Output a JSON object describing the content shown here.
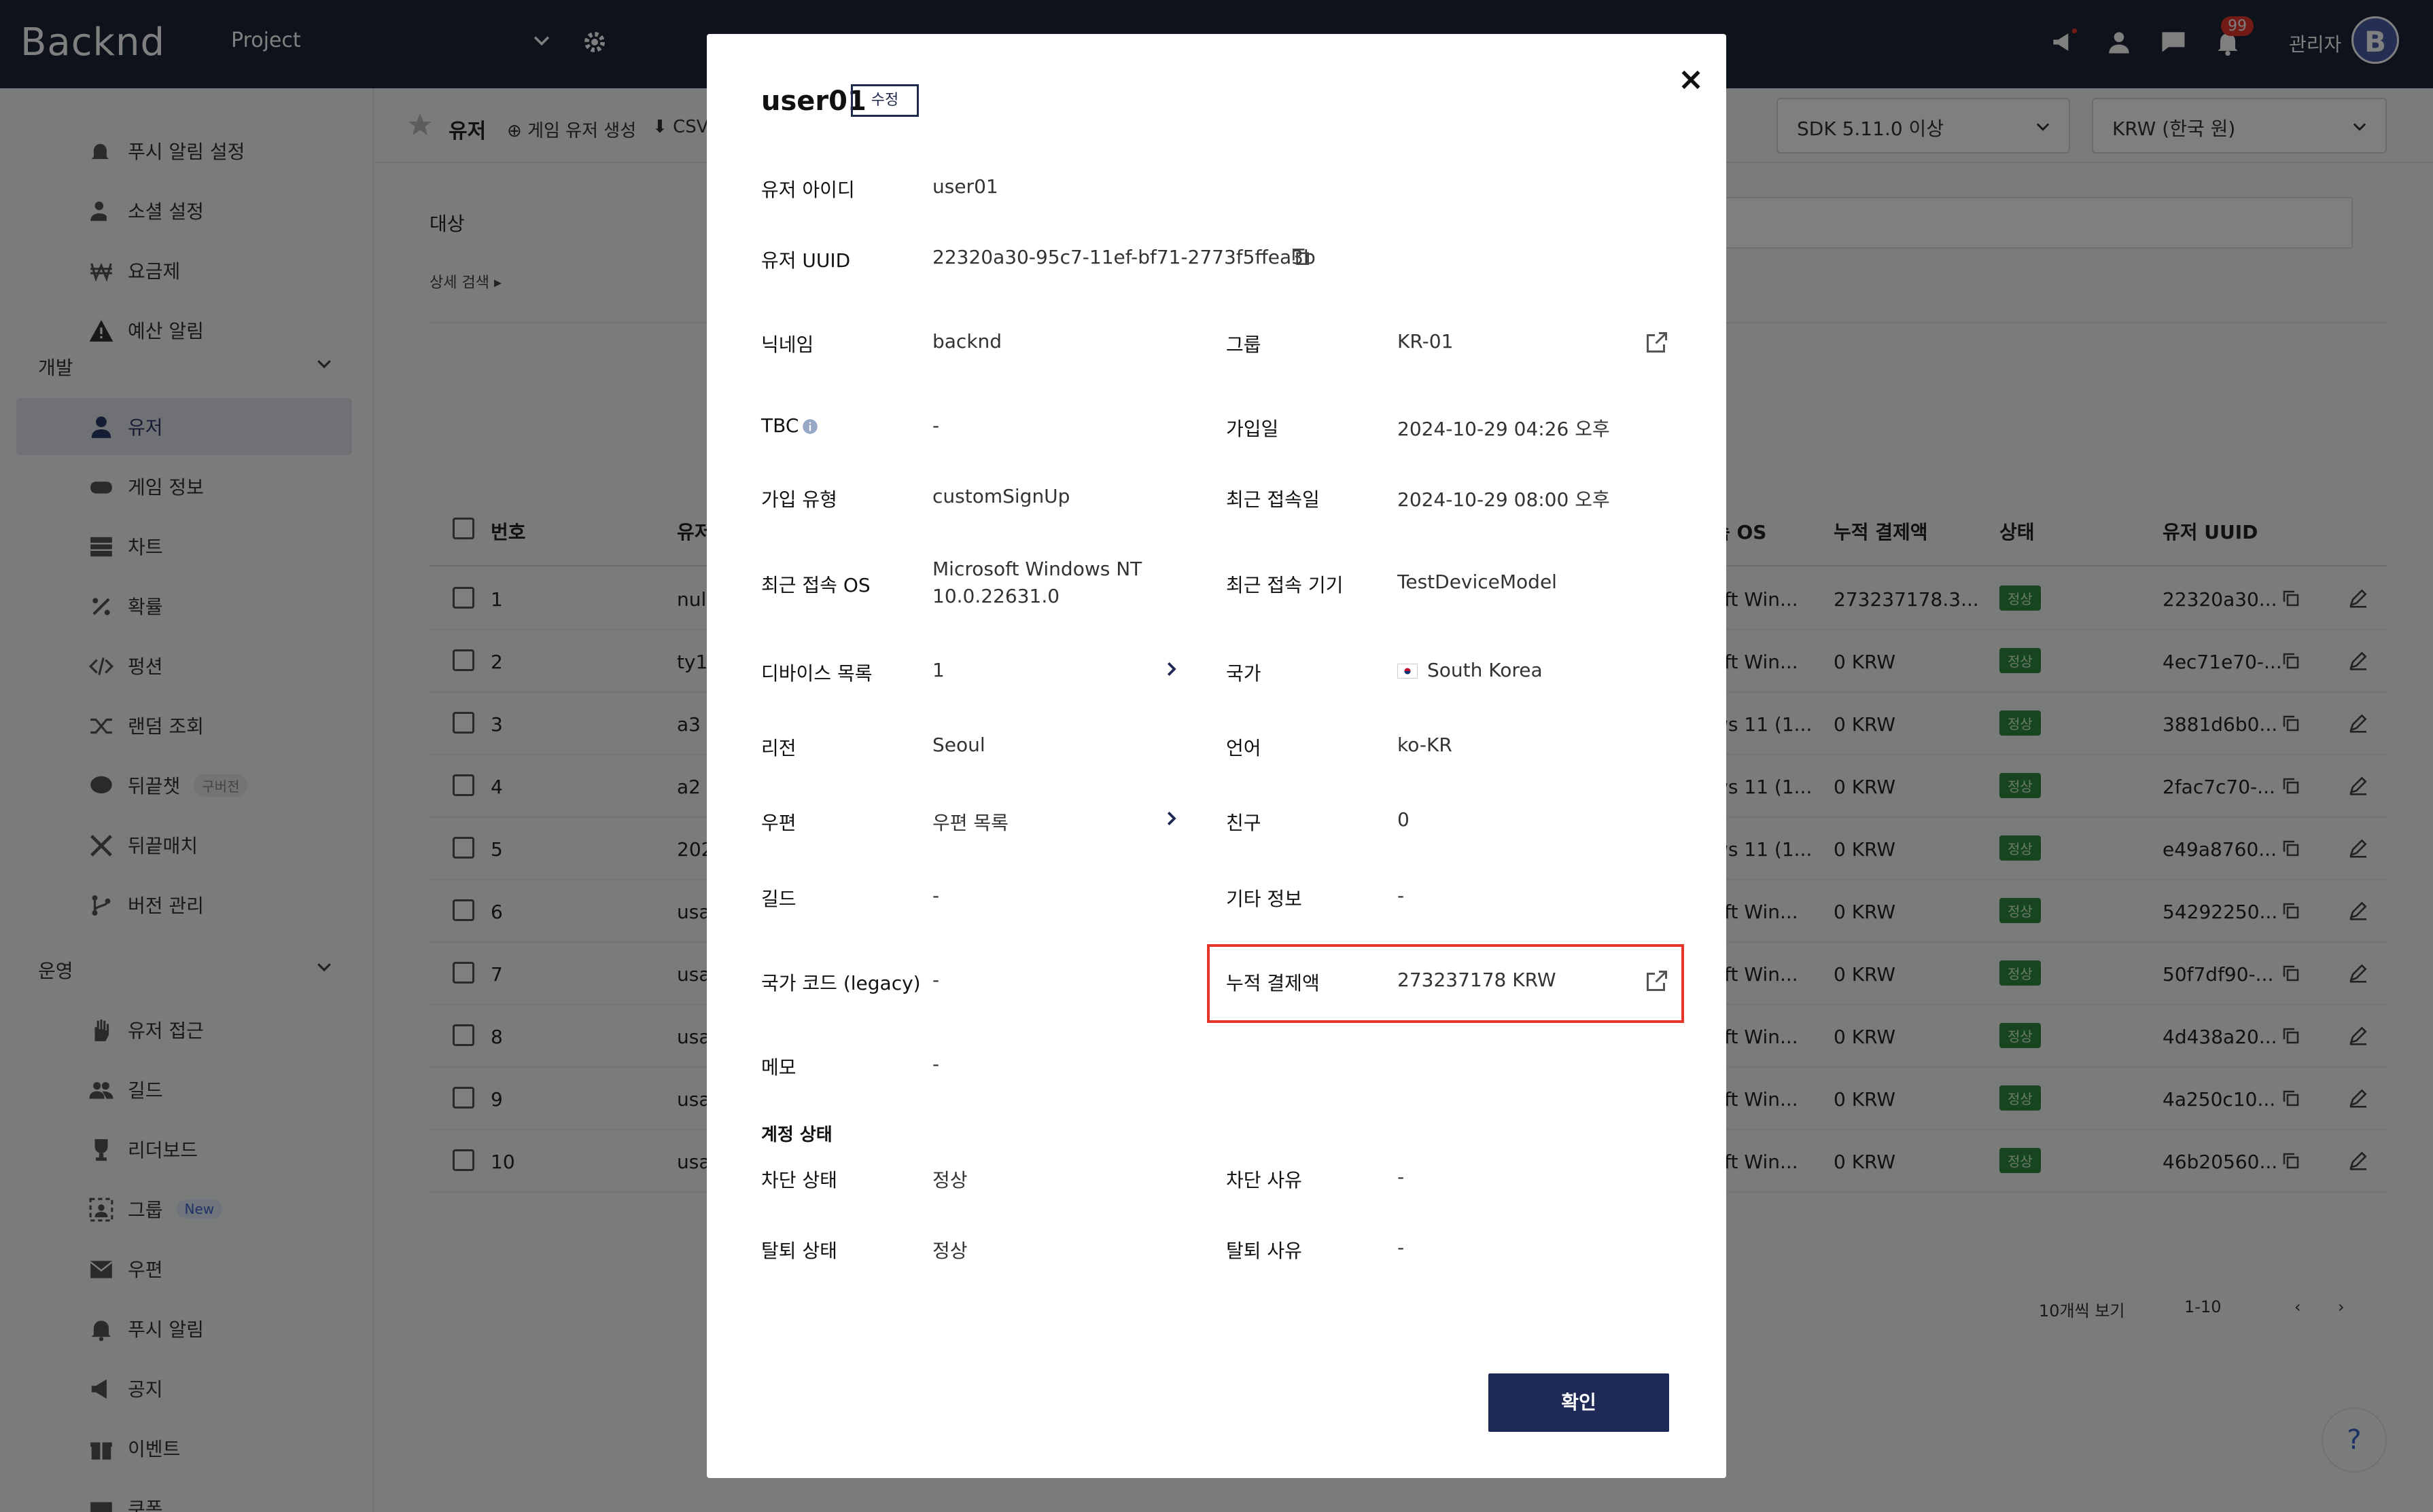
{
  "topbar": {
    "logo": "Backnd",
    "project": "Project",
    "notification_count": "99",
    "admin_label": "관리자",
    "avatar_letter": "B"
  },
  "sidebar": {
    "items_top": [
      {
        "label": "푸시 알림 설정",
        "icon": "bell-gear-icon"
      },
      {
        "label": "소셜 설정",
        "icon": "user-gear-icon"
      },
      {
        "label": "요금제",
        "icon": "won-icon"
      },
      {
        "label": "예산 알림",
        "icon": "warning-icon"
      }
    ],
    "group_dev": "개발",
    "items_dev": [
      {
        "label": "유저",
        "icon": "user-icon",
        "active": true
      },
      {
        "label": "게임 정보",
        "icon": "gamepad-icon"
      },
      {
        "label": "차트",
        "icon": "table-icon"
      },
      {
        "label": "확률",
        "icon": "percent-icon"
      },
      {
        "label": "펑션",
        "icon": "code-icon"
      },
      {
        "label": "랜덤 조회",
        "icon": "shuffle-icon"
      },
      {
        "label": "뒤끝챗",
        "icon": "chat-icon",
        "pill": "구버전"
      },
      {
        "label": "뒤끝매치",
        "icon": "swords-icon"
      },
      {
        "label": "버전 관리",
        "icon": "branch-icon"
      }
    ],
    "group_ops": "운영",
    "items_ops": [
      {
        "label": "유저 접근",
        "icon": "hand-icon"
      },
      {
        "label": "길드",
        "icon": "users-icon"
      },
      {
        "label": "리더보드",
        "icon": "trophy-icon"
      },
      {
        "label": "그룹",
        "icon": "group-icon",
        "pill": "New"
      },
      {
        "label": "우편",
        "icon": "mail-icon"
      },
      {
        "label": "푸시 알림",
        "icon": "bell-icon"
      },
      {
        "label": "공지",
        "icon": "megaphone-icon"
      },
      {
        "label": "이벤트",
        "icon": "gift-icon"
      },
      {
        "label": "쿠폰",
        "icon": "coupon-icon"
      }
    ]
  },
  "main": {
    "title": "유저",
    "create_user": "게임 유저 생성",
    "csv": "CSV",
    "sdk_select": "SDK 5.11.0 이상",
    "currency_select": "KRW (한국 원)",
    "target_label": "대상",
    "advanced_search": "상세 검색 ▸",
    "headers": {
      "number": "번호",
      "user": "유저",
      "os": "속 OS",
      "paid": "누적 결제액",
      "status": "상태",
      "uuid": "유저 UUID"
    },
    "rows": [
      {
        "num": "1",
        "user": "null",
        "os": "oft Win...",
        "paid": "273237178.3...",
        "status": "정상",
        "uuid": "22320a30..."
      },
      {
        "num": "2",
        "user": "ty1",
        "os": "oft Win...",
        "paid": "0 KRW",
        "status": "정상",
        "uuid": "4ec71e70-..."
      },
      {
        "num": "3",
        "user": "a3",
        "os": "ws 11 (1...",
        "paid": "0 KRW",
        "status": "정상",
        "uuid": "3881d6b0..."
      },
      {
        "num": "4",
        "user": "a2",
        "os": "ws 11 (1...",
        "paid": "0 KRW",
        "status": "정상",
        "uuid": "2fac7c70-..."
      },
      {
        "num": "5",
        "user": "202",
        "os": "ws 11 (1...",
        "paid": "0 KRW",
        "status": "정상",
        "uuid": "e49a8760..."
      },
      {
        "num": "6",
        "user": "usa",
        "os": "oft Win...",
        "paid": "0 KRW",
        "status": "정상",
        "uuid": "54292250..."
      },
      {
        "num": "7",
        "user": "usa",
        "os": "oft Win...",
        "paid": "0 KRW",
        "status": "정상",
        "uuid": "50f7df90-..."
      },
      {
        "num": "8",
        "user": "usa",
        "os": "oft Win...",
        "paid": "0 KRW",
        "status": "정상",
        "uuid": "4d438a20..."
      },
      {
        "num": "9",
        "user": "usa",
        "os": "oft Win...",
        "paid": "0 KRW",
        "status": "정상",
        "uuid": "4a250c10..."
      },
      {
        "num": "10",
        "user": "usa",
        "os": "oft Win...",
        "paid": "0 KRW",
        "status": "정상",
        "uuid": "46b20560..."
      }
    ],
    "page_size": "10개씩 보기",
    "page_range": "1-10",
    "help": "?"
  },
  "modal": {
    "title": "user01",
    "edit": "수정",
    "close": "×",
    "fields": {
      "user_id_label": "유저 아이디",
      "user_id": "user01",
      "uuid_label": "유저 UUID",
      "uuid": "22320a30-95c7-11ef-bf71-2773f5ffea3b",
      "nickname_label": "닉네임",
      "nickname": "backnd",
      "group_label": "그룹",
      "group": "KR-01",
      "tbc_label": "TBC",
      "tbc": "-",
      "joined_label": "가입일",
      "joined": "2024-10-29 04:26 오후",
      "signup_type_label": "가입 유형",
      "signup_type": "customSignUp",
      "last_access_label": "최근 접속일",
      "last_access": "2024-10-29 08:00 오후",
      "last_os_label": "최근 접속 OS",
      "last_os": "Microsoft Windows NT 10.0.22631.0",
      "last_device_label": "최근 접속 기기",
      "last_device": "TestDeviceModel",
      "devices_label": "디바이스 목록",
      "devices": "1",
      "country_label": "국가",
      "country": "South Korea",
      "region_label": "리전",
      "region": "Seoul",
      "language_label": "언어",
      "language": "ko-KR",
      "mail_label": "우편",
      "mail": "우편 목록",
      "friends_label": "친구",
      "friends": "0",
      "guild_label": "길드",
      "guild": "-",
      "extra_label": "기타 정보",
      "extra": "-",
      "country_code_label": "국가 코드 (legacy)",
      "country_code": "-",
      "paid_label": "누적 결제액",
      "paid": "273237178 KRW",
      "memo_label": "메모",
      "memo": "-"
    },
    "account_section": "계정 상태",
    "ban_status_label": "차단 상태",
    "ban_status": "정상",
    "ban_reason_label": "차단 사유",
    "ban_reason": "-",
    "withdraw_status_label": "탈퇴 상태",
    "withdraw_status": "정상",
    "withdraw_reason_label": "탈퇴 사유",
    "withdraw_reason": "-",
    "confirm": "확인"
  },
  "colors": {
    "topbar": "#1b2436",
    "accent": "#1e2a55",
    "highlight": "#e5352b",
    "status_green": "#2e8b3e"
  }
}
